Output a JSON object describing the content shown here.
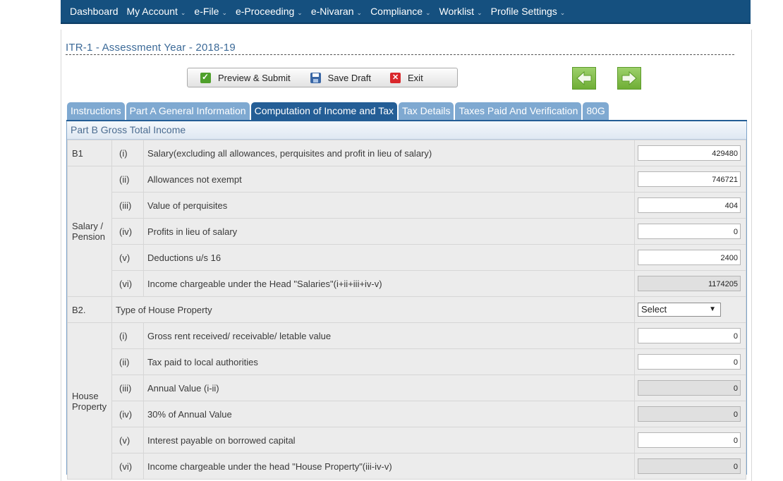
{
  "nav": [
    {
      "label": "Dashboard",
      "caret": false
    },
    {
      "label": "My Account",
      "caret": true
    },
    {
      "label": "e-File",
      "caret": true
    },
    {
      "label": "e-Proceeding",
      "caret": true
    },
    {
      "label": "e-Nivaran",
      "caret": true
    },
    {
      "label": "Compliance",
      "caret": true
    },
    {
      "label": "Worklist",
      "caret": true
    },
    {
      "label": "Profile Settings",
      "caret": true
    }
  ],
  "page_title": "ITR-1 - Assessment Year - 2018-19",
  "toolbar": {
    "preview": "Preview & Submit",
    "save": "Save Draft",
    "exit": "Exit"
  },
  "tabs": [
    {
      "label": "Instructions"
    },
    {
      "label": "Part A General Information"
    },
    {
      "label": "Computation of Income and Tax",
      "active": true
    },
    {
      "label": "Tax Details"
    },
    {
      "label": "Taxes Paid And Verification"
    },
    {
      "label": "80G"
    }
  ],
  "section_title": "Part B Gross Total Income",
  "b1": {
    "code": "B1",
    "group_label": "Salary / Pension",
    "rows": [
      {
        "sub": "(i)",
        "desc": "Salary(excluding all allowances, perquisites and profit in lieu of salary)",
        "value": "429480"
      },
      {
        "sub": "(ii)",
        "desc": "Allowances not exempt",
        "value": "746721"
      },
      {
        "sub": "(iii)",
        "desc": "Value of perquisites",
        "value": "404"
      },
      {
        "sub": "(iv)",
        "desc": "Profits in lieu of salary",
        "value": "0"
      },
      {
        "sub": "(v)",
        "desc": "Deductions u/s 16",
        "value": "2400"
      },
      {
        "sub": "(vi)",
        "desc": "Income chargeable under the Head \"Salaries\"(i+ii+iii+iv-v)",
        "value": "1174205",
        "readonly": true
      }
    ]
  },
  "b2": {
    "code": "B2.",
    "type_label": "Type of House Property",
    "select_value": "Select",
    "group_label": "House Property",
    "rows": [
      {
        "sub": "(i)",
        "desc": "Gross rent received/ receivable/ letable value",
        "value": "0"
      },
      {
        "sub": "(ii)",
        "desc": "Tax paid to local authorities",
        "value": "0"
      },
      {
        "sub": "(iii)",
        "desc": "Annual Value (i-ii)",
        "value": "0",
        "readonly": true
      },
      {
        "sub": "(iv)",
        "desc": "30% of Annual Value",
        "value": "0",
        "readonly": true
      },
      {
        "sub": "(v)",
        "desc": "Interest payable on borrowed capital",
        "value": "0"
      },
      {
        "sub": "(vi)",
        "desc": "Income chargeable under the head \"House Property\"(iii-iv-v)",
        "value": "0",
        "readonly": true
      }
    ]
  },
  "colors": {
    "nav_bg": "#15507f",
    "tab": "#7fa9d1",
    "tab_active": "#245e96",
    "title": "#3c6a98"
  }
}
